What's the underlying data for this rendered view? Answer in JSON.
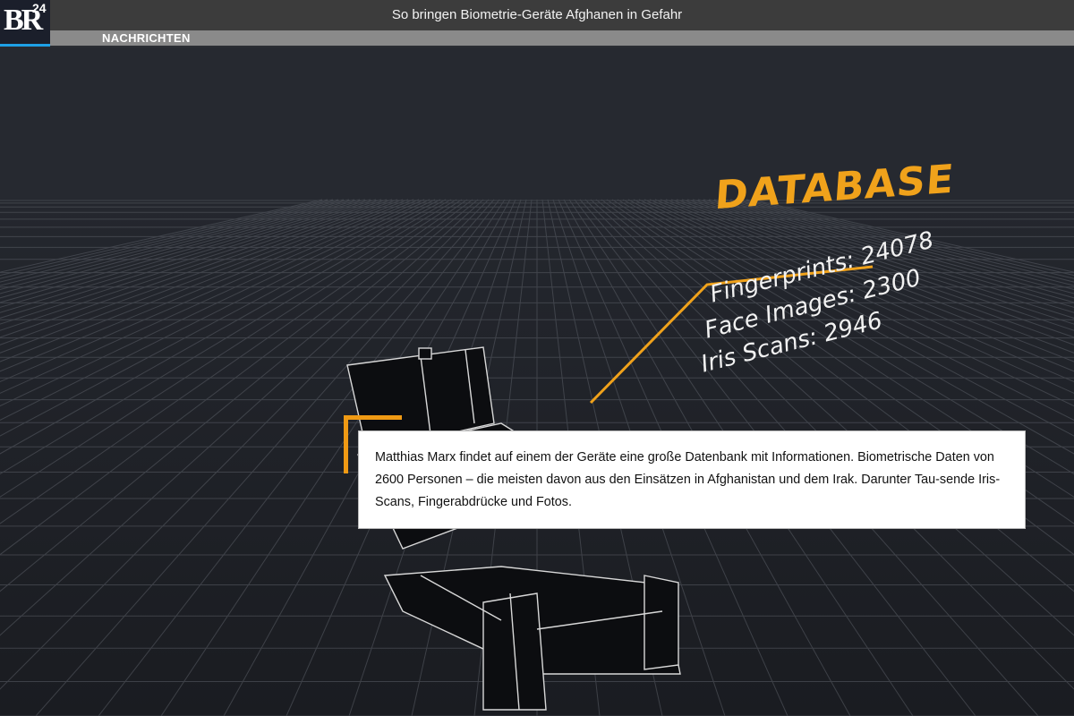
{
  "header": {
    "logo_text": "BR",
    "logo_superscript": "24",
    "title": "So bringen Biometrie-Geräte Afghanen in Gefahr",
    "section": "NACHRICHTEN"
  },
  "scene": {
    "database_label": "DATABASE",
    "stats": [
      "Fingerprints: 24078",
      "Face Images: 2300",
      "Iris Scans: 2946"
    ],
    "accent_color": "#f0a21b"
  },
  "caption": {
    "text": "Matthias Marx findet auf einem der Geräte eine große Datenbank mit Informationen. Biometrische Daten von 2600 Personen – die meisten davon aus den Einsätzen in Afghanistan und dem Irak. Darunter Tau-sende Iris-Scans, Fingerabdrücke und Fotos."
  }
}
